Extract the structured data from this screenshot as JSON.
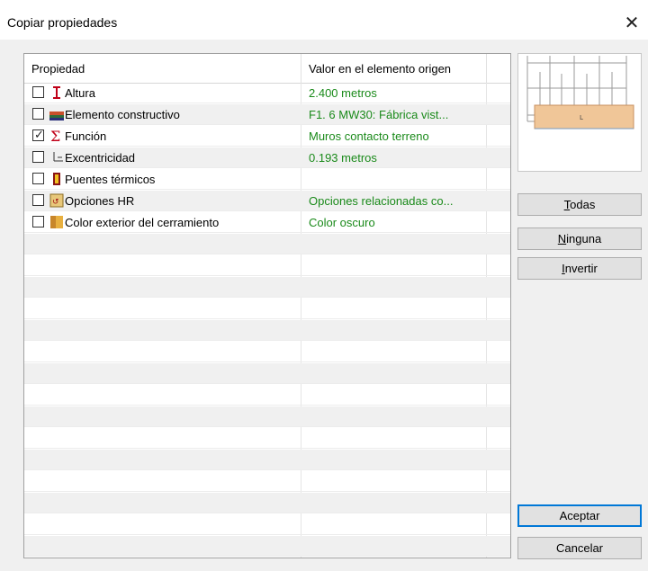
{
  "window": {
    "title": "Copiar propiedades"
  },
  "table": {
    "headers": {
      "property": "Propiedad",
      "value": "Valor en el elemento origen"
    },
    "rows": [
      {
        "label": "Altura",
        "value": "2.400 metros",
        "checked": false,
        "icon": "height-icon"
      },
      {
        "label": "Elemento constructivo",
        "value": "F1. 6 MW30: Fábrica vist...",
        "checked": false,
        "icon": "construction-element-icon"
      },
      {
        "label": "Función",
        "value": "Muros contacto terreno",
        "checked": true,
        "icon": "sigma-icon"
      },
      {
        "label": "Excentricidad",
        "value": "0.193 metros",
        "checked": false,
        "icon": "eccentricity-icon"
      },
      {
        "label": "Puentes térmicos",
        "value": "",
        "checked": false,
        "icon": "thermal-bridge-icon"
      },
      {
        "label": "Opciones HR",
        "value": "Opciones relacionadas co...",
        "checked": false,
        "icon": "hr-options-icon"
      },
      {
        "label": "Color exterior del cerramiento",
        "value": "Color oscuro",
        "checked": false,
        "icon": "exterior-color-icon"
      }
    ]
  },
  "buttons": {
    "todas": {
      "first": "T",
      "rest": "odas"
    },
    "ninguna": {
      "first": "N",
      "rest": "inguna"
    },
    "invertir": {
      "first": "I",
      "rest": "nvertir"
    },
    "aceptar": "Aceptar",
    "cancelar": "Cancelar"
  },
  "colors": {
    "value_text": "#1a8a1a",
    "default_button_border": "#0078d7"
  },
  "icons": {
    "close": "close-icon"
  }
}
